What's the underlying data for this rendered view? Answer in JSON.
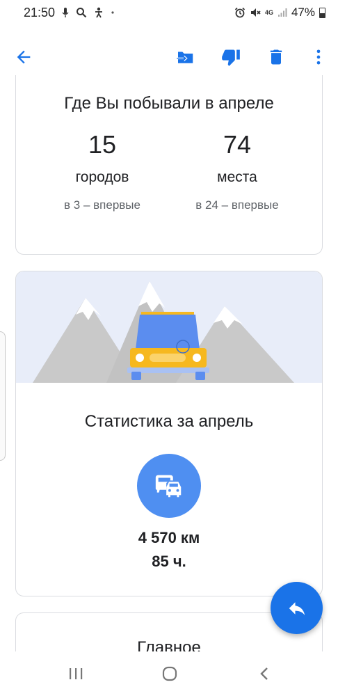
{
  "status_bar": {
    "time": "21:50",
    "network": "4G",
    "battery": "47%"
  },
  "toolbar": {
    "back": "arrow-back-icon",
    "move": "move-to-inbox-icon",
    "dislike": "thumb-down-icon",
    "delete": "trash-icon",
    "more": "more-vert-icon"
  },
  "visited": {
    "title": "Где Вы побывали в апреле",
    "cities": {
      "value": "15",
      "label": "городов",
      "sub": "в 3 – впервые"
    },
    "places": {
      "value": "74",
      "label": "места",
      "sub": "в 24 – впервые"
    }
  },
  "stats": {
    "title": "Статистика за апрель",
    "distance": "4 570 км",
    "hours": "85 ч."
  },
  "next_card": {
    "title": "Главное"
  },
  "colors": {
    "accent": "#1a73e8",
    "badge": "#4f8ff1",
    "car_body": "#5b8def",
    "car_bumper": "#f6b81f",
    "sky": "#e8edf9",
    "mountain": "#c9c9c9"
  }
}
